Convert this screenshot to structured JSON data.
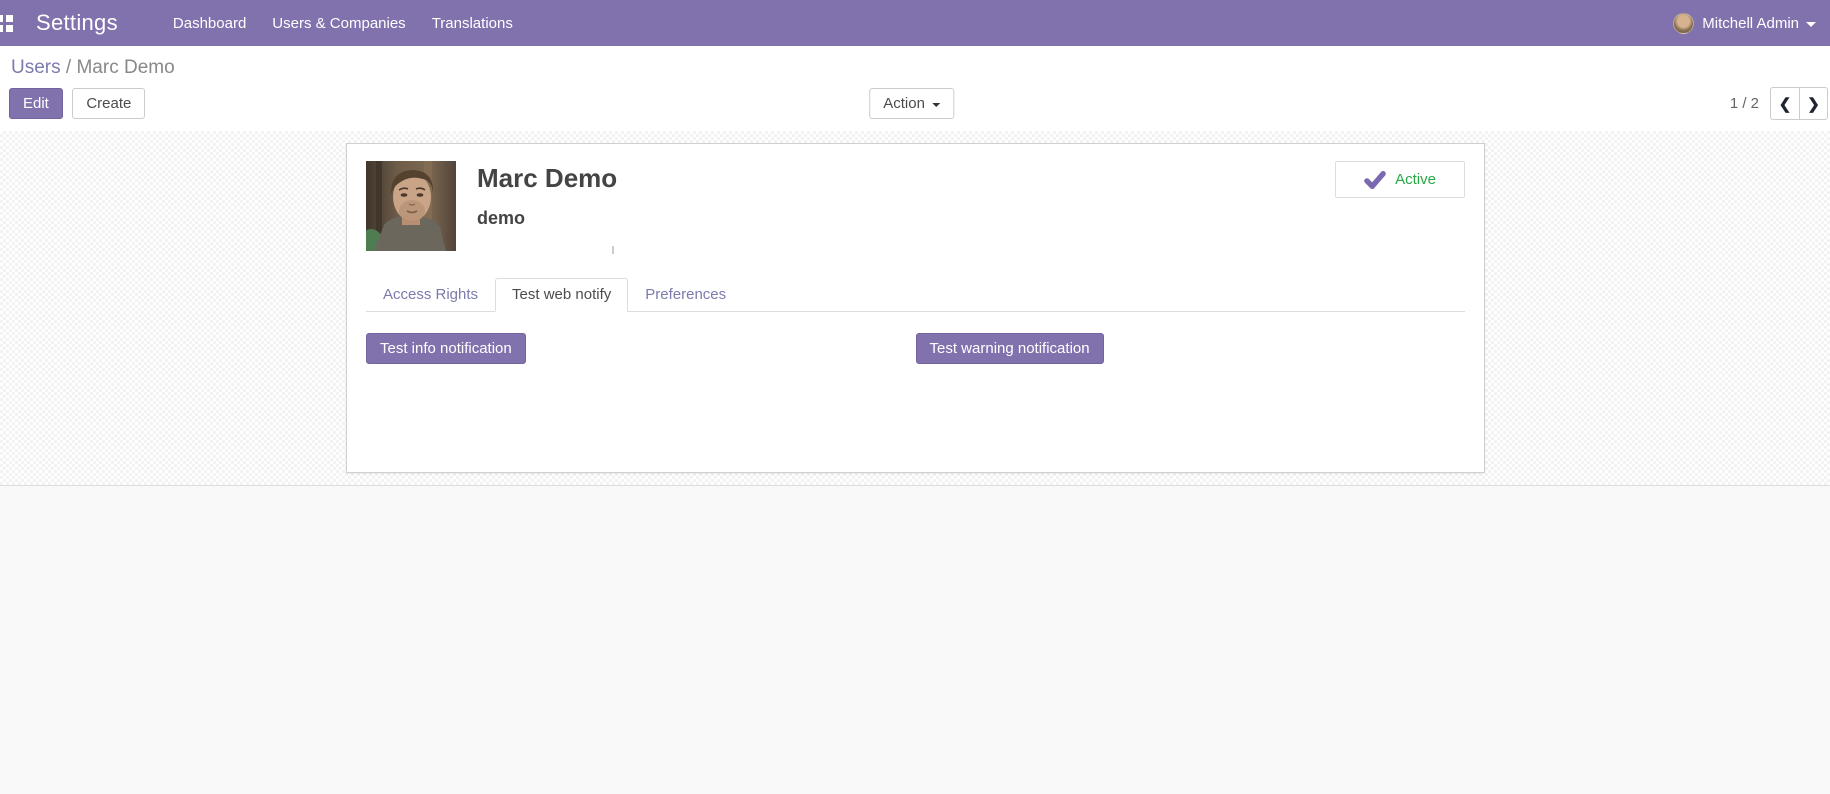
{
  "navbar": {
    "app_title": "Settings",
    "menu_items": [
      {
        "label": "Dashboard"
      },
      {
        "label": "Users & Companies"
      },
      {
        "label": "Translations"
      }
    ],
    "user_name": "Mitchell Admin",
    "icons": {
      "apps": "grid-icon",
      "user_caret": "chevron-down-icon"
    },
    "colors": {
      "bg": "#8171AD",
      "text": "#FFFFFF"
    }
  },
  "breadcrumb": {
    "parent": "Users",
    "separator": "/",
    "current": "Marc Demo"
  },
  "control_panel": {
    "edit_label": "Edit",
    "create_label": "Create",
    "action_label": "Action",
    "pager": {
      "text": "1 / 2",
      "prev_icon": "❮",
      "next_icon": "❯"
    }
  },
  "sheet": {
    "user": {
      "name": "Marc Demo",
      "login": "demo"
    },
    "status_badge": {
      "label": "Active",
      "icon": "check-icon",
      "label_color": "#28a745",
      "check_color": "#7A68B0"
    },
    "tabs": [
      {
        "label": "Access Rights",
        "active": false
      },
      {
        "label": "Test web notify",
        "active": true
      },
      {
        "label": "Preferences",
        "active": false
      }
    ],
    "buttons": [
      {
        "label": "Test info notification"
      },
      {
        "label": "Test warning notification"
      }
    ],
    "colors": {
      "primary_button": "#8171AD",
      "link": "#7C7BAD"
    }
  }
}
